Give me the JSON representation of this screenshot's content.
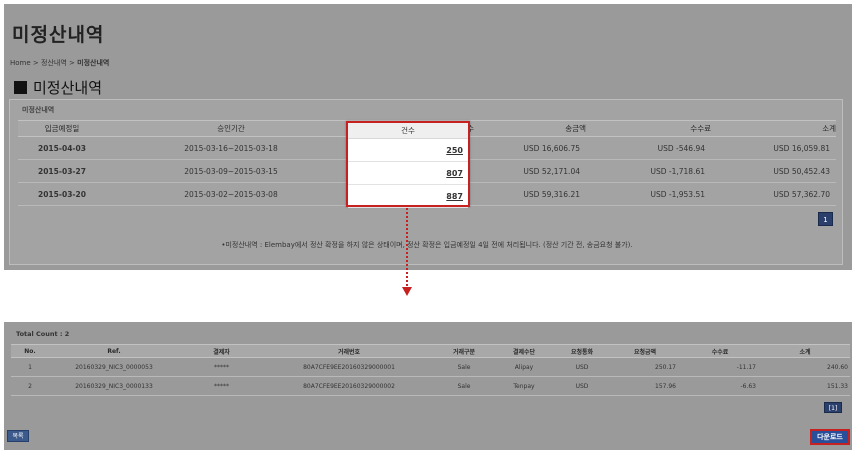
{
  "page_title": "미정산내역",
  "breadcrumb": {
    "home": "Home",
    "sep1": ">",
    "mid": "정산내역",
    "sep2": ">",
    "current": "미정산내역"
  },
  "section_heading": "미정산내역",
  "summary_panel": {
    "title": "미정산내역",
    "headers": [
      "입금예정일",
      "승인기간",
      "건수",
      "송금액",
      "수수료",
      "소계"
    ],
    "rows": [
      {
        "due_date": "2015-04-03",
        "period": "2015-03-16~2015-03-18",
        "count": "250",
        "amount": "USD 16,606.75",
        "fee": "USD -546.94",
        "subtotal": "USD 16,059.81"
      },
      {
        "due_date": "2015-03-27",
        "period": "2015-03-09~2015-03-15",
        "count": "807",
        "amount": "USD 52,171.04",
        "fee": "USD -1,718.61",
        "subtotal": "USD 50,452.43"
      },
      {
        "due_date": "2015-03-20",
        "period": "2015-03-02~2015-03-08",
        "count": "887",
        "amount": "USD 59,316.21",
        "fee": "USD -1,953.51",
        "subtotal": "USD 57,362.70"
      }
    ],
    "pager": "1",
    "note": "•미정산내역 : Elembay에서 정산 확정을 하지 않은 상태이며, 정산 확정은 입금예정일 4일 전에 처리됩니다. (정산 기간 전, 송금요청 불가)."
  },
  "detail_panel": {
    "total_count": "Total Count : 2",
    "headers": [
      "No.",
      "Ref.",
      "결제자",
      "거래번호",
      "거래구분",
      "결제수단",
      "요청통화",
      "요청금액",
      "수수료",
      "소계"
    ],
    "rows": [
      [
        "1",
        "20160329_NIC3_0000053",
        "*****",
        "80A7CFE9EE20160329000001",
        "Sale",
        "Alipay",
        "USD",
        "250.17",
        "-11.17",
        "240.60"
      ],
      [
        "2",
        "20160329_NIC3_0000133",
        "*****",
        "80A7CFE9EE20160329000002",
        "Sale",
        "Tenpay",
        "USD",
        "157.96",
        "-6.63",
        "151.33"
      ]
    ],
    "pager": "[1]",
    "list_button": "목록",
    "download_button": "다운로드"
  },
  "colors": {
    "highlight": "#c62020",
    "button_blue": "#2a4f9a",
    "dim_overlay": "#9a9a9a"
  }
}
